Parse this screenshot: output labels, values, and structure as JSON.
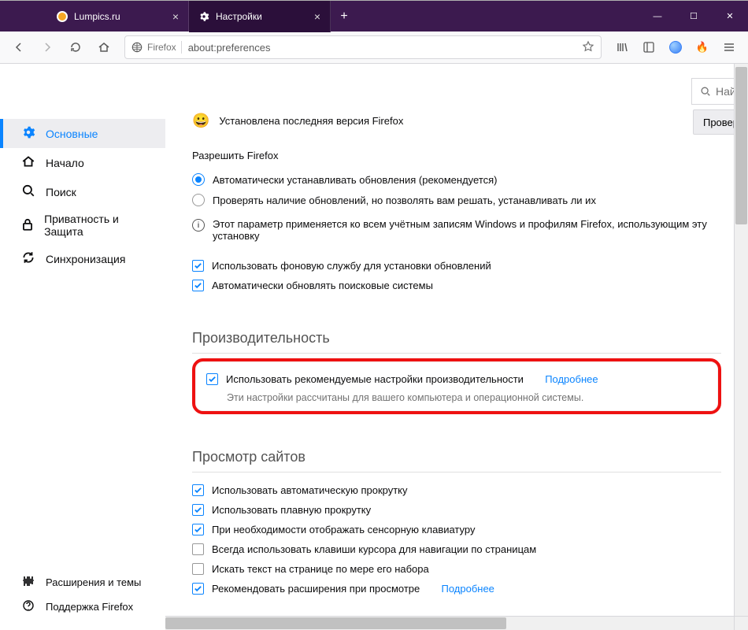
{
  "window": {
    "tabs": [
      {
        "label": "Lumpics.ru",
        "favicon": "#f5a623"
      },
      {
        "label": "Настройки",
        "favicon": "gear"
      }
    ],
    "newtab": "+",
    "controls": {
      "min": "—",
      "max": "☐",
      "close": "✕"
    }
  },
  "navbar": {
    "identity_label": "Firefox",
    "url": "about:preferences",
    "icons": {
      "library": "|||\\",
      "menu": "≡"
    }
  },
  "search": {
    "icon": "🔍",
    "placeholder": "Най"
  },
  "sidebar": {
    "items": [
      {
        "label": "Основные",
        "icon": "gear"
      },
      {
        "label": "Начало",
        "icon": "home"
      },
      {
        "label": "Поиск",
        "icon": "search"
      },
      {
        "label": "Приватность и Защита",
        "icon": "lock"
      },
      {
        "label": "Синхронизация",
        "icon": "sync"
      }
    ],
    "footer": [
      {
        "label": "Расширения и темы",
        "icon": "puzzle"
      },
      {
        "label": "Поддержка Firefox",
        "icon": "help"
      }
    ]
  },
  "updates": {
    "status": "Установлена последняя версия Firefox",
    "check_btn": "Провер",
    "allow_label": "Разрешить Firefox",
    "radio_auto": "Автоматически устанавливать обновления (рекомендуется)",
    "radio_manual": "Проверять наличие обновлений, но позволять вам решать, устанавливать ли их",
    "info": "Этот параметр применяется ко всем учётным записям Windows и профилям Firefox, использующим эту установку",
    "chk_bg": "Использовать фоновую службу для установки обновлений",
    "chk_engines": "Автоматически обновлять поисковые системы"
  },
  "performance": {
    "title": "Производительность",
    "chk_rec": "Использовать рекомендуемые настройки производительности",
    "learn_more": "Подробнее",
    "sub": "Эти настройки рассчитаны для вашего компьютера и операционной системы."
  },
  "browsing": {
    "title": "Просмотр сайтов",
    "chk_autoscroll": "Использовать автоматическую прокрутку",
    "chk_smooth": "Использовать плавную прокрутку",
    "chk_touchkb": "При необходимости отображать сенсорную клавиатуру",
    "chk_caret": "Всегда использовать клавиши курсора для навигации по страницам",
    "chk_typeahead": "Искать текст на странице по мере его набора",
    "chk_recext": "Рекомендовать расширения при просмотре",
    "learn_more": "Подробнее"
  }
}
